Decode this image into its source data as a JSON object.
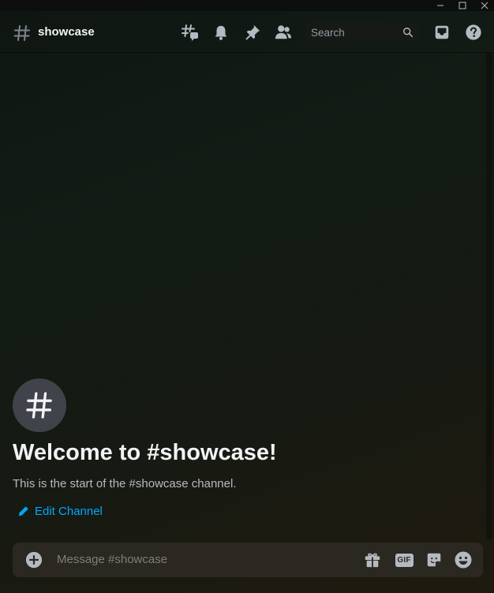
{
  "window": {
    "minimize_icon": "minimize-icon",
    "maximize_icon": "maximize-icon",
    "close_icon": "close-icon"
  },
  "header": {
    "channel_name": "showcase",
    "search_placeholder": "Search",
    "icons": [
      "threads-icon",
      "bell-icon",
      "pin-icon",
      "members-icon",
      "search-icon",
      "inbox-icon",
      "help-icon"
    ]
  },
  "welcome": {
    "title": "Welcome to #showcase!",
    "subtitle": "This is the start of the #showcase channel.",
    "edit_label": "Edit Channel"
  },
  "composer": {
    "placeholder": "Message #showcase",
    "gif_label": "GIF"
  },
  "colors": {
    "accent_link": "#00a8fc",
    "text_primary": "#f2f3f5",
    "text_muted": "#b5bac1",
    "icon_bubble": "#41434a",
    "composer_bg": "#2a2820"
  }
}
